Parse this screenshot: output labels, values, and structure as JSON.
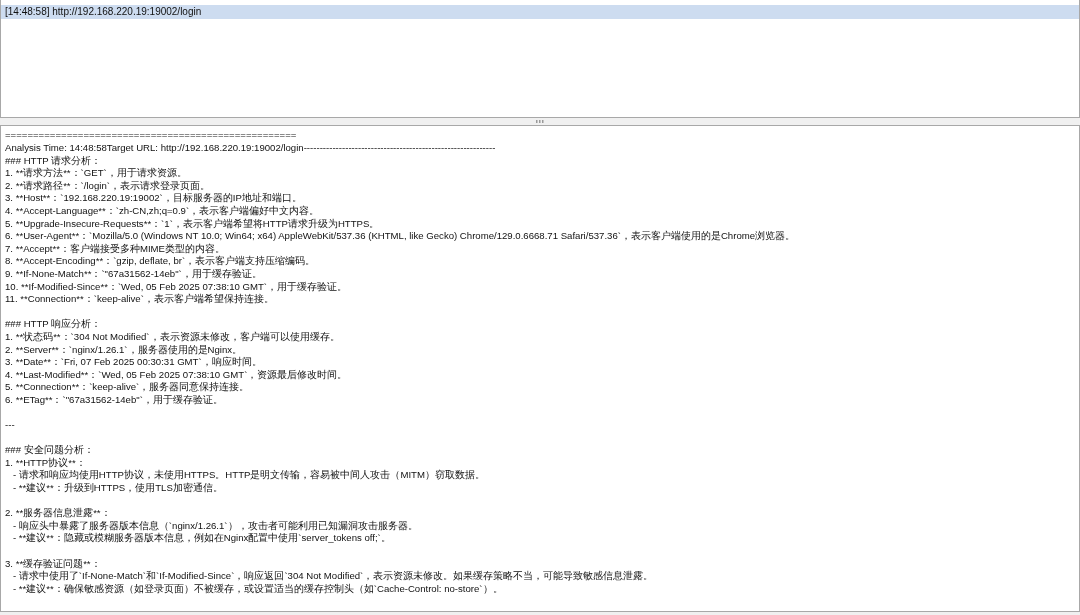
{
  "request_list": [
    {
      "time": "[14:48:58]",
      "url": "http://192.168.220.19:19002/login",
      "selected": true
    }
  ],
  "analysis_output": {
    "blocks": [
      [
        "====================================================",
        "Analysis Time: 14:48:58Target URL: http://192.168.220.19:19002/login------------------------------------------------------------",
        "### HTTP 请求分析：",
        "1. **请求方法**：`GET`，用于请求资源。",
        "2. **请求路径**：`/login`，表示请求登录页面。",
        "3. **Host**：`192.168.220.19:19002`，目标服务器的IP地址和端口。",
        "4. **Accept-Language**：`zh-CN,zh;q=0.9`，表示客户端偏好中文内容。",
        "5. **Upgrade-Insecure-Requests**：`1`，表示客户端希望将HTTP请求升级为HTTPS。",
        "6. **User-Agent**：`Mozilla/5.0 (Windows NT 10.0; Win64; x64) AppleWebKit/537.36 (KHTML, like Gecko) Chrome/129.0.6668.71 Safari/537.36`，表示客户端使用的是Chrome浏览器。",
        "7. **Accept**：客户端接受多种MIME类型的内容。",
        "8. **Accept-Encoding**：`gzip, deflate, br`，表示客户端支持压缩编码。",
        "9. **If-None-Match**：`\"67a31562-14eb\"`，用于缓存验证。",
        "10. **If-Modified-Since**：`Wed, 05 Feb 2025 07:38:10 GMT`，用于缓存验证。",
        "11. **Connection**：`keep-alive`，表示客户端希望保持连接。"
      ],
      [
        "### HTTP 响应分析：",
        "1. **状态码**：`304 Not Modified`，表示资源未修改，客户端可以使用缓存。",
        "2. **Server**：`nginx/1.26.1`，服务器使用的是Nginx。",
        "3. **Date**：`Fri, 07 Feb 2025 00:30:31 GMT`，响应时间。",
        "4. **Last-Modified**：`Wed, 05 Feb 2025 07:38:10 GMT`，资源最后修改时间。",
        "5. **Connection**：`keep-alive`，服务器同意保持连接。",
        "6. **ETag**：`\"67a31562-14eb\"`，用于缓存验证。"
      ],
      [
        "---"
      ],
      [
        "### 安全问题分析：",
        "1. **HTTP协议**：",
        "   - 请求和响应均使用HTTP协议，未使用HTTPS。HTTP是明文传输，容易被中间人攻击（MITM）窃取数据。",
        "   - **建议**：升级到HTTPS，使用TLS加密通信。"
      ],
      [
        "2. **服务器信息泄露**：",
        "   - 响应头中暴露了服务器版本信息（`nginx/1.26.1`），攻击者可能利用已知漏洞攻击服务器。",
        "   - **建议**：隐藏或模糊服务器版本信息，例如在Nginx配置中使用`server_tokens off;`。"
      ],
      [
        "3. **缓存验证问题**：",
        "   - 请求中使用了`If-None-Match`和`If-Modified-Since`，响应返回`304 Not Modified`，表示资源未修改。如果缓存策略不当，可能导致敏感信息泄露。",
        "   - **建议**：确保敏感资源（如登录页面）不被缓存，或设置适当的缓存控制头（如`Cache-Control: no-store`）。"
      ]
    ]
  }
}
